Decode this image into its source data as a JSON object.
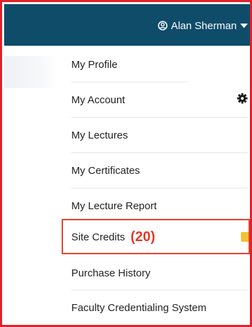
{
  "header": {
    "user_name": "Alan Sherman",
    "user_icon": "user-circle-icon",
    "caret_icon": "caret-down-icon"
  },
  "menu": {
    "items": [
      {
        "label": "My Profile"
      },
      {
        "label": "My Account",
        "icon": "gear-icon"
      },
      {
        "label": "My Lectures"
      },
      {
        "label": "My Certificates"
      },
      {
        "label": "My Lecture Report"
      },
      {
        "label": "Site Credits",
        "count": "(20)",
        "highlighted": true
      },
      {
        "label": "Purchase History"
      },
      {
        "label": "Faculty Credentialing System"
      }
    ]
  },
  "colors": {
    "header_bg": "#0f4c6a",
    "frame_border": "#e0202a",
    "highlight_border": "#e8402c",
    "count_text": "#e03a2a",
    "chip": "#f1c233"
  }
}
